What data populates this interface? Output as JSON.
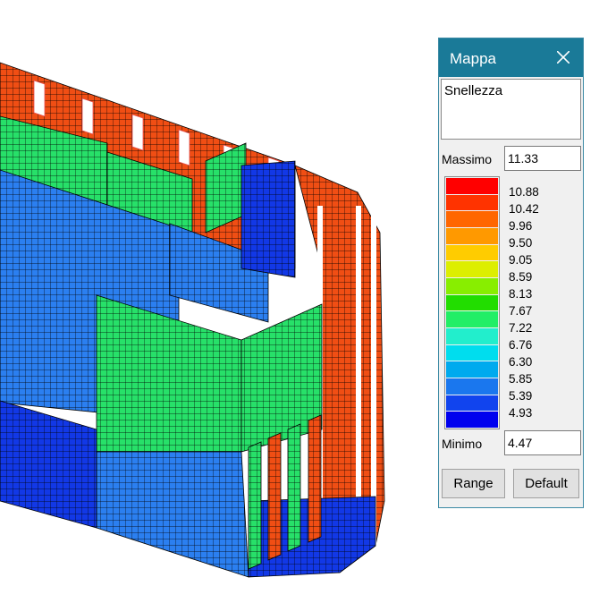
{
  "panel": {
    "title": "Mappa",
    "quantity": "Snellezza",
    "max_label": "Massimo",
    "max_value": "11.33",
    "min_label": "Minimo",
    "min_value": "4.47",
    "range_button": "Range",
    "default_button": "Default"
  },
  "legend": {
    "colors": [
      "#ff0000",
      "#ff3300",
      "#ff6600",
      "#ff9900",
      "#ffcc00",
      "#ddee00",
      "#88ee00",
      "#22dd00",
      "#22ee66",
      "#22eecc",
      "#00ddee",
      "#00aaee",
      "#1a77ee",
      "#1144ee",
      "#0000ee"
    ],
    "ticks": [
      "10.88",
      "10.42",
      "9.96",
      "9.50",
      "9.05",
      "8.59",
      "8.13",
      "7.67",
      "7.22",
      "6.76",
      "6.30",
      "5.85",
      "5.39",
      "4.93"
    ]
  },
  "model_colors": {
    "red": "#f04e14",
    "green": "#27e069",
    "blue_light": "#2b7ff0",
    "blue_dark": "#1238e6",
    "mesh": "#000000"
  }
}
